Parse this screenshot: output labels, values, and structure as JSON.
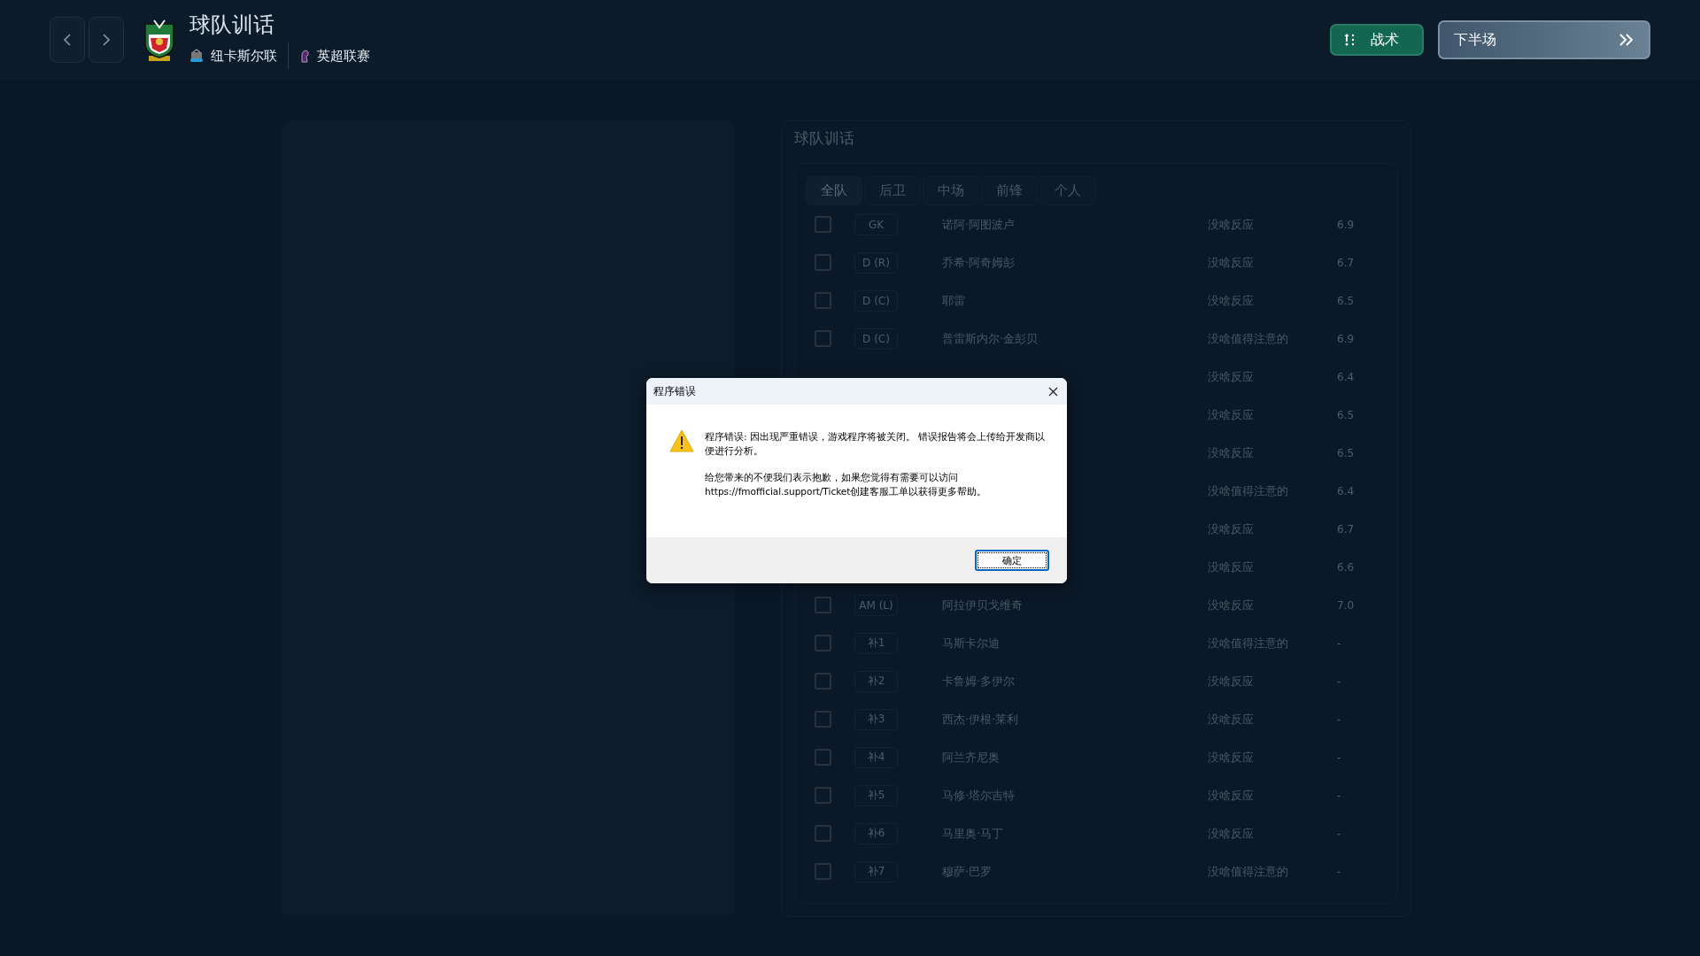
{
  "header": {
    "title": "球队训话",
    "club": "纽卡斯尔联",
    "league": "英超联赛",
    "tactics_button": "战术",
    "next_button": "下半场"
  },
  "panel": {
    "title": "球队训话",
    "tabs": [
      {
        "label": "全队",
        "selected": true
      },
      {
        "label": "后卫",
        "selected": false
      },
      {
        "label": "中场",
        "selected": false
      },
      {
        "label": "前锋",
        "selected": false
      },
      {
        "label": "个人",
        "selected": false
      }
    ],
    "rows": [
      {
        "checked": false,
        "position": "GK",
        "name": "诺阿·阿图波卢",
        "reaction": "没啥反应",
        "rating": "6.9"
      },
      {
        "checked": false,
        "position": "D (R)",
        "name": "乔希·阿奇姆彭",
        "reaction": "没啥反应",
        "rating": "6.7"
      },
      {
        "checked": false,
        "position": "D (C)",
        "name": "耶雷",
        "reaction": "没啥反应",
        "rating": "6.5"
      },
      {
        "checked": false,
        "position": "D (C)",
        "name": "普雷斯内尔·金彭贝",
        "reaction": "没啥值得注意的",
        "rating": "6.9"
      },
      {
        "reaction": "没啥反应",
        "rating": "6.4"
      },
      {
        "reaction": "没啥反应",
        "rating": "6.5"
      },
      {
        "reaction": "没啥反应",
        "rating": "6.5"
      },
      {
        "reaction": "没啥值得注意的",
        "rating": "6.4"
      },
      {
        "reaction": "没啥反应",
        "rating": "6.7"
      },
      {
        "reaction": "没啥反应",
        "rating": "6.6"
      },
      {
        "checked": false,
        "position": "AM (L)",
        "name": "阿拉伊贝戈维奇",
        "reaction": "没啥反应",
        "rating": "7.0"
      },
      {
        "checked": false,
        "position": "补1",
        "name": "马斯卡尔迪",
        "reaction": "没啥值得注意的",
        "rating": "-"
      },
      {
        "checked": false,
        "position": "补2",
        "name": "卡鲁姆·多伊尔",
        "reaction": "没啥反应",
        "rating": "-"
      },
      {
        "checked": false,
        "position": "补3",
        "name": "西杰·伊根·莱利",
        "reaction": "没啥反应",
        "rating": "-"
      },
      {
        "checked": false,
        "position": "补4",
        "name": "阿兰齐尼奥",
        "reaction": "没啥反应",
        "rating": "-"
      },
      {
        "checked": false,
        "position": "补5",
        "name": "马修·塔尔吉特",
        "reaction": "没啥反应",
        "rating": "-"
      },
      {
        "checked": false,
        "position": "补6",
        "name": "马里奥·马丁",
        "reaction": "没啥反应",
        "rating": "-"
      },
      {
        "checked": false,
        "position": "补7",
        "name": "穆萨·巴罗",
        "reaction": "没啥值得注意的",
        "rating": "-"
      }
    ]
  },
  "dialog": {
    "title": "程序错误",
    "message": "程序错误: 因出现严重错误，游戏程序将被关闭。 错误报告将会上传给开发商以便进行分析。",
    "message_2": "给您带来的不便我们表示抱歉，如果您觉得有需要可以访问 https://fmofficial.support/Ticket创建客服工单以获得更多帮助。",
    "ok_button": "确定"
  }
}
